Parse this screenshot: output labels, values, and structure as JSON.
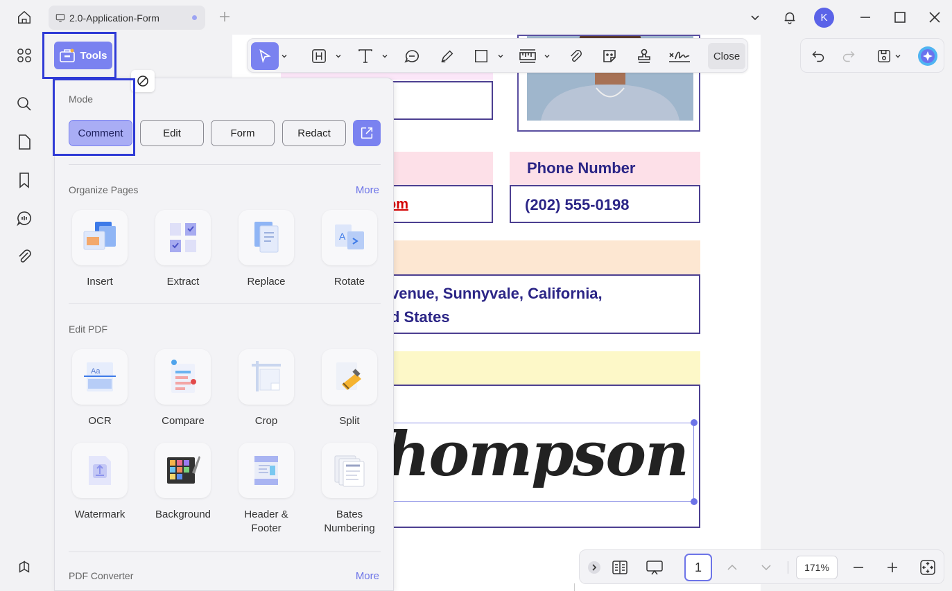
{
  "tab": {
    "title": "2.0-Application-Form"
  },
  "user": {
    "initial": "K"
  },
  "tools_button": {
    "label": "Tools"
  },
  "toolbar": {
    "close_label": "Close"
  },
  "panel": {
    "mode": {
      "title": "Mode",
      "buttons": [
        "Comment",
        "Edit",
        "Form",
        "Redact"
      ],
      "active": "Comment"
    },
    "organize": {
      "title": "Organize Pages",
      "more": "More",
      "items": [
        "Insert",
        "Extract",
        "Replace",
        "Rotate"
      ]
    },
    "edit_pdf": {
      "title": "Edit PDF",
      "items": [
        "OCR",
        "Compare",
        "Crop",
        "Split",
        "Watermark",
        "Background",
        "Header & Footer",
        "Bates Numbering"
      ]
    },
    "converter": {
      "title": "PDF Converter",
      "more": "More"
    }
  },
  "document": {
    "phone_label": "Phone Number",
    "phone_value": "(202) 555-0198",
    "email_fragment": "om",
    "address_line1": "venue, Sunnyvale, California,",
    "address_line2": "d States",
    "signature": "n · Thompson"
  },
  "bottombar": {
    "page": "1",
    "zoom": "171%"
  },
  "colors": {
    "accent": "#7a82f0",
    "doc_text": "#2b2586",
    "highlight_box": "#2f3bd6"
  }
}
